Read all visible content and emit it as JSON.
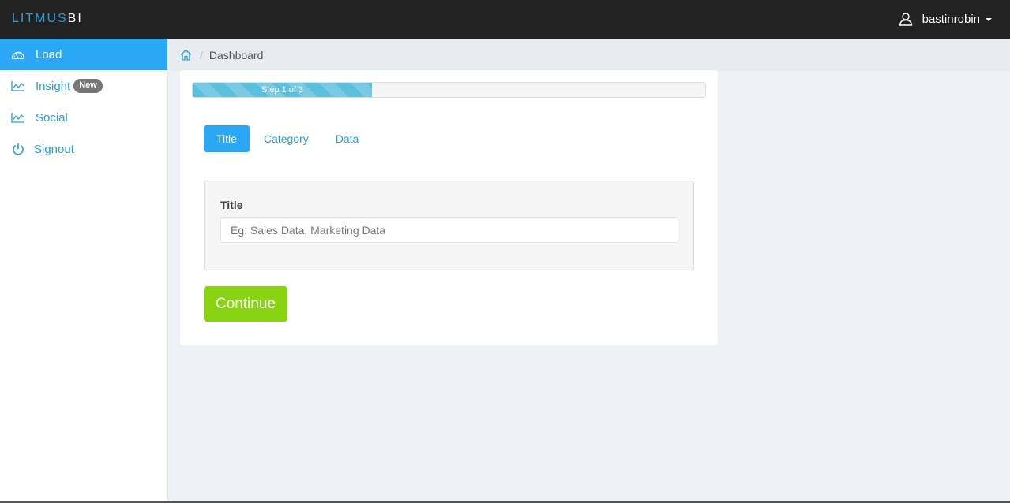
{
  "brand": {
    "part1": "LITMUS",
    "part2": "BI"
  },
  "user": {
    "name": "bastinrobin",
    "icon": "user-icon"
  },
  "sidebar": {
    "items": [
      {
        "label": "Load",
        "icon": "dashboard-icon",
        "active": true
      },
      {
        "label": "Insight",
        "icon": "chart-line-icon",
        "badge": "New"
      },
      {
        "label": "Social",
        "icon": "chart-line-icon"
      },
      {
        "label": "Signout",
        "icon": "power-icon"
      }
    ]
  },
  "breadcrumb": {
    "home_icon": "home-icon",
    "separator": "/",
    "current": "Dashboard"
  },
  "progress": {
    "label": "Step 1 of 3",
    "fraction": 0.35
  },
  "tabs": [
    {
      "label": "Title",
      "active": true
    },
    {
      "label": "Category"
    },
    {
      "label": "Data"
    }
  ],
  "form": {
    "title_label": "Title",
    "title_placeholder": "Eg: Sales Data, Marketing Data",
    "title_value": ""
  },
  "continue_label": "Continue",
  "colors": {
    "accent": "#2aa8f5",
    "brand_blue": "#2a9fd6",
    "continue_green": "#88d412",
    "navbar": "#222222",
    "progress": "#5bc0de"
  }
}
